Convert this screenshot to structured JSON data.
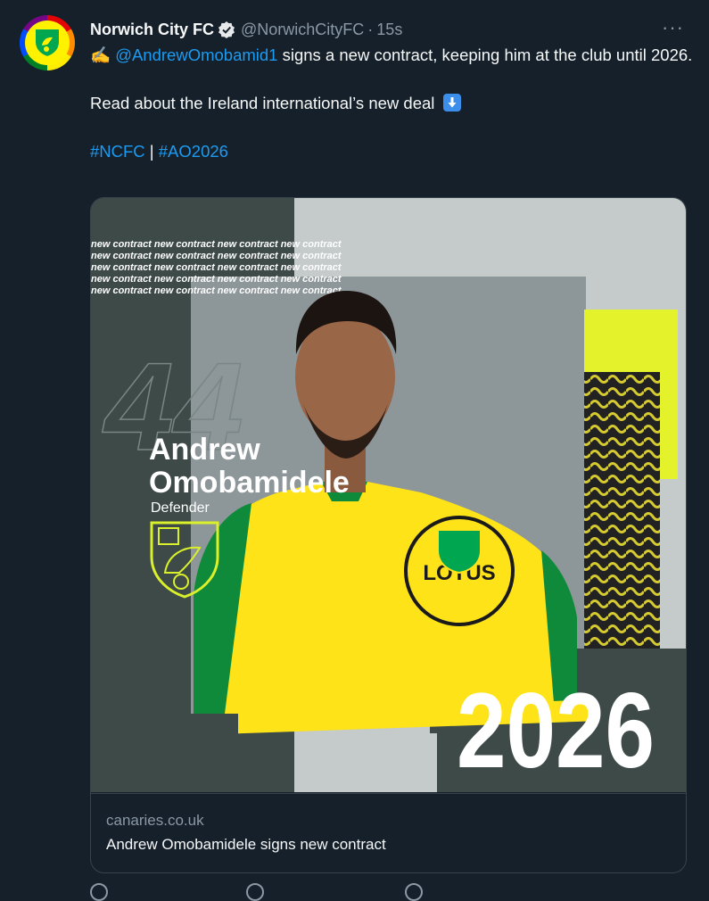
{
  "tweet": {
    "name": "Norwich City FC",
    "handle": "@NorwichCityFC",
    "separator": "·",
    "time": "15s",
    "more": "···",
    "line1_emoji": "✍️",
    "mention": "@AndrewOmobamid1",
    "line1_rest": " signs a new contract, keeping him at the club until 2026.",
    "line2": "Read about the Ireland international’s new deal",
    "hashtag1": "#NCFC",
    "hashtag_separator": " | ",
    "hashtag2": "#AO2026"
  },
  "graphic": {
    "repeat_text": "new contract new contract new contract new contract",
    "number": "44",
    "first_name": "Andrew",
    "last_name": "Omobamidele",
    "position": "Defender",
    "sponsor": "LOTUS",
    "year": "2026"
  },
  "card": {
    "domain": "canaries.co.uk",
    "title": "Andrew Omobamidele signs new contract"
  },
  "colors": {
    "background": "#15202b",
    "accent_link": "#1d9bf0",
    "muted": "#8b98a5",
    "brand_yellow": "#fff200",
    "brand_green": "#00a650"
  }
}
